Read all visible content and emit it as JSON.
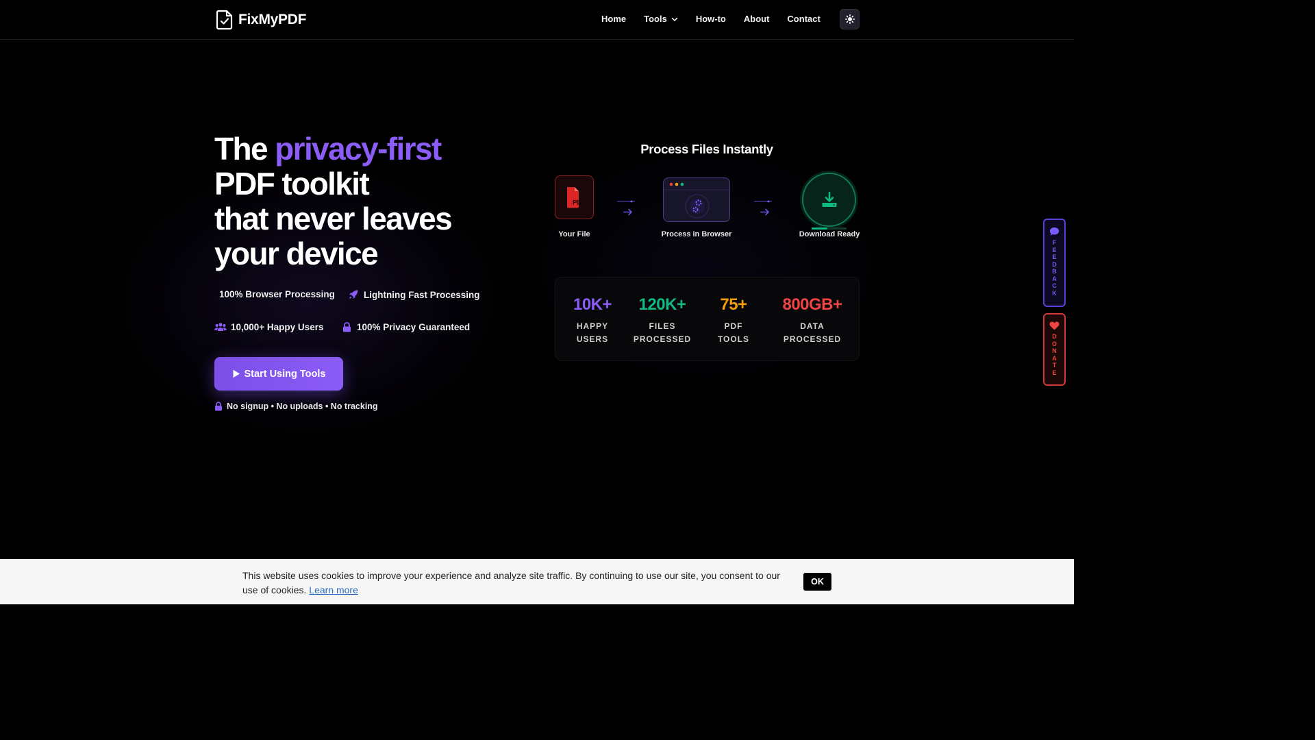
{
  "nav": {
    "logo_text": "FixMyPDF",
    "links": [
      "Home",
      "Tools",
      "How-to",
      "About",
      "Contact"
    ]
  },
  "hero": {
    "title_part1": "The ",
    "title_accent": "privacy-first",
    "title_line2": "PDF toolkit",
    "title_line3": "that never leaves",
    "title_line4": "your device",
    "features": [
      "100% Browser Processing",
      "Lightning Fast Processing",
      "10,000+ Happy Users",
      "100% Privacy Guaranteed"
    ],
    "cta_label": "Start Using Tools",
    "note": "No signup • No uploads • No tracking"
  },
  "process": {
    "title": "Process Files Instantly",
    "steps": [
      "Your File",
      "Process in Browser",
      "Download Ready"
    ],
    "pdf_badge": "PDF",
    "download_progress": 0.45
  },
  "stats": [
    {
      "value": "10K+",
      "label_line1": "HAPPY",
      "label_line2": "USERS",
      "color": "#8b5cf6"
    },
    {
      "value": "120K+",
      "label_line1": "FILES",
      "label_line2": "PROCESSED",
      "color": "#10b981"
    },
    {
      "value": "75+",
      "label_line1": "PDF",
      "label_line2": "TOOLS",
      "color": "#f59e0b"
    },
    {
      "value": "800GB+",
      "label_line1": "DATA",
      "label_line2": "PROCESSED",
      "color": "#ef4444"
    }
  ],
  "side_tabs": {
    "feedback": "FEEDBACK",
    "donate": "DONATE"
  },
  "cookie": {
    "text": "This website uses cookies to improve your experience and analyze site traffic. By continuing to use our site, you consent to our use of cookies.",
    "link": "Learn more",
    "ok_label": "OK"
  },
  "colors": {
    "accent": "#8b5cf6",
    "background": "#000000",
    "pdf_red": "#dc2626",
    "download_green": "#10b981"
  },
  "icons": {
    "logo": "file-check-icon",
    "theme": "sun-icon",
    "feature_fast": "rocket-icon",
    "feature_users": "users-icon",
    "feature_privacy": "lock-icon",
    "cta": "play-icon",
    "feedback": "chat-icon",
    "donate": "heart-icon",
    "download": "download-icon"
  }
}
